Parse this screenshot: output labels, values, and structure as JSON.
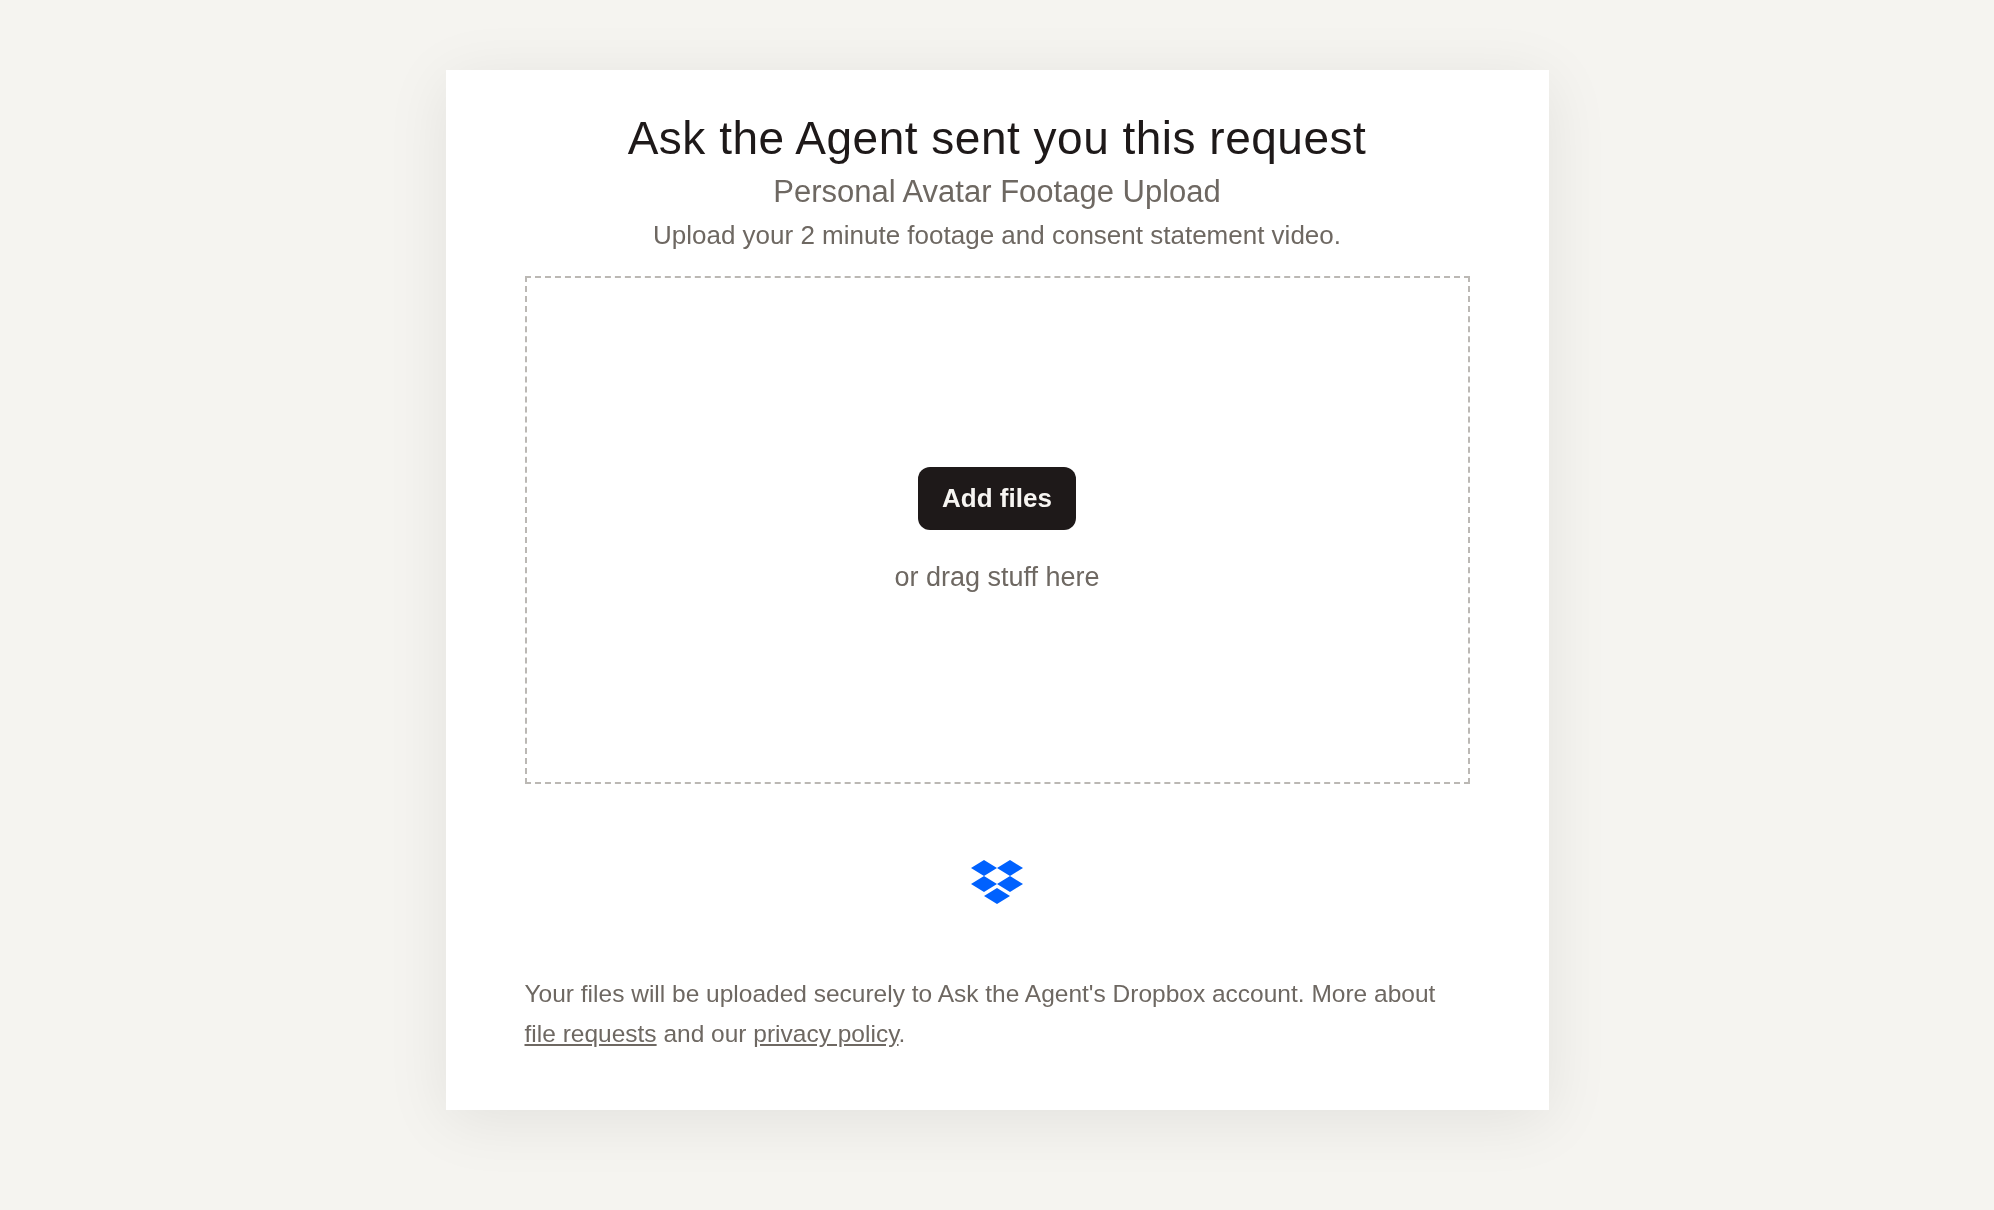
{
  "title": "Ask the Agent sent you this request",
  "subtitle": "Personal Avatar Footage Upload",
  "description": "Upload your 2 minute footage and consent statement video.",
  "dropzone": {
    "button": "Add files",
    "hint": "or drag stuff here"
  },
  "footer": [
    {
      "kind": "text",
      "text": "Your files will be uploaded securely to Ask the Agent's Dropbox account. More about "
    },
    {
      "kind": "link",
      "text": "file requests"
    },
    {
      "kind": "text",
      "text": " and our "
    },
    {
      "kind": "link",
      "text": "privacy policy"
    },
    {
      "kind": "text",
      "text": "."
    }
  ]
}
